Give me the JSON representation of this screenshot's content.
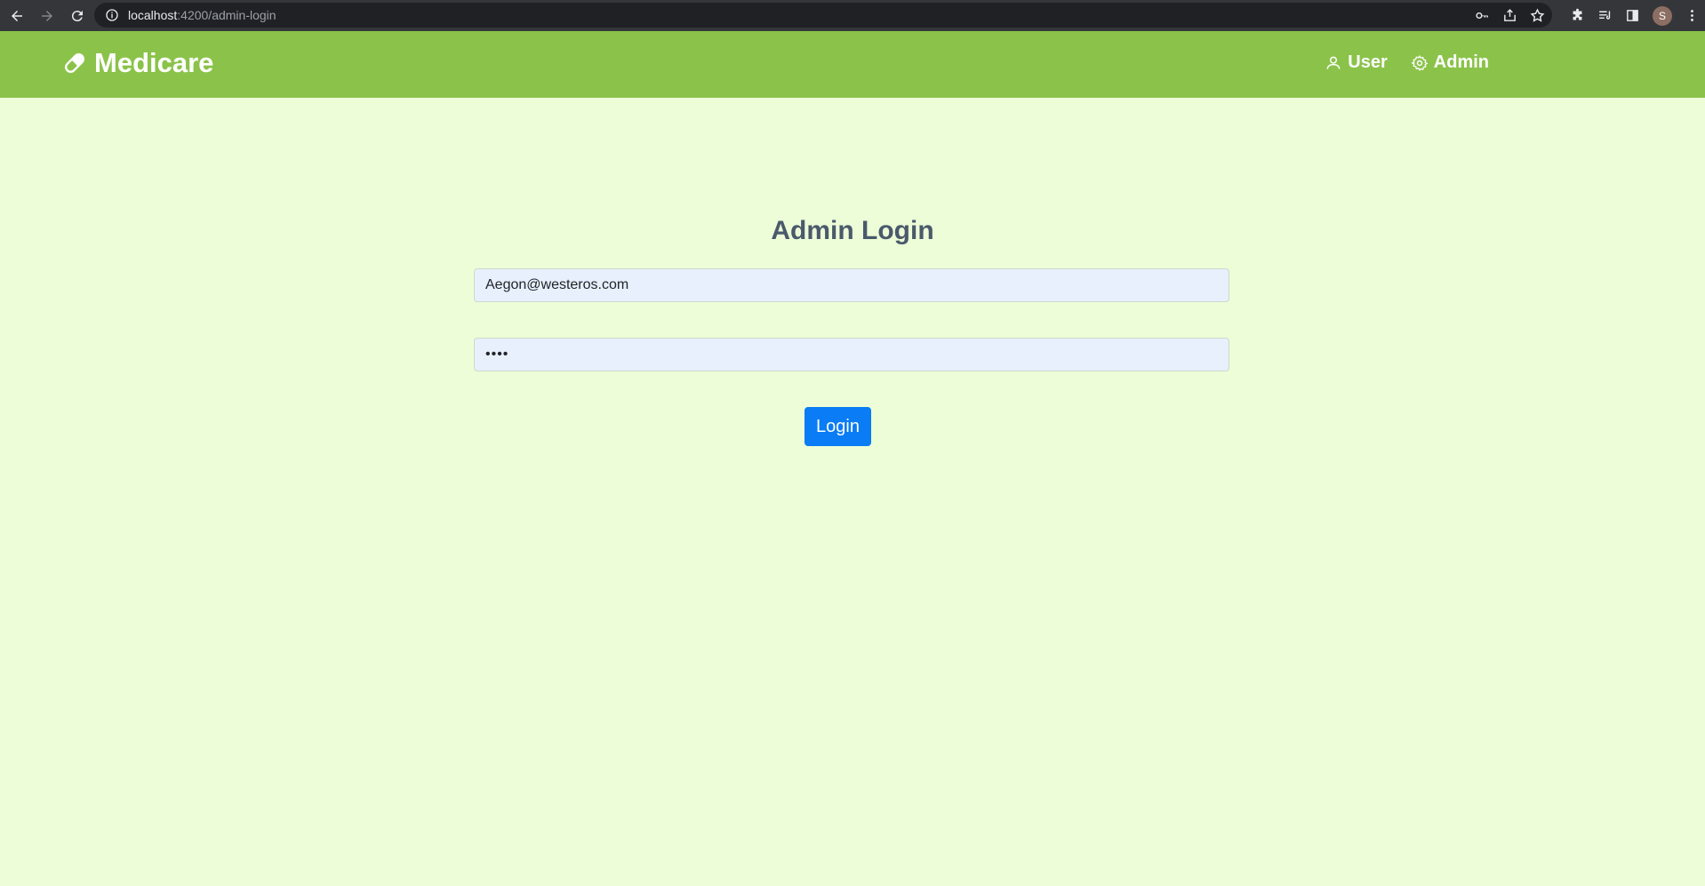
{
  "browser": {
    "url_host": "localhost",
    "url_path": ":4200/admin-login",
    "profile_initial": "S"
  },
  "header": {
    "brand": "Medicare",
    "nav": [
      {
        "label": "User",
        "icon": "user-icon"
      },
      {
        "label": "Admin",
        "icon": "gear-icon"
      }
    ]
  },
  "login": {
    "title": "Admin Login",
    "email_value": "Aegon@westeros.com",
    "password_value": "••••",
    "button_label": "Login"
  },
  "colors": {
    "header_bg": "#8bc34a",
    "page_bg": "#edfdd8",
    "button_bg": "#0a7cf5",
    "title_color": "#4a5a6b"
  }
}
